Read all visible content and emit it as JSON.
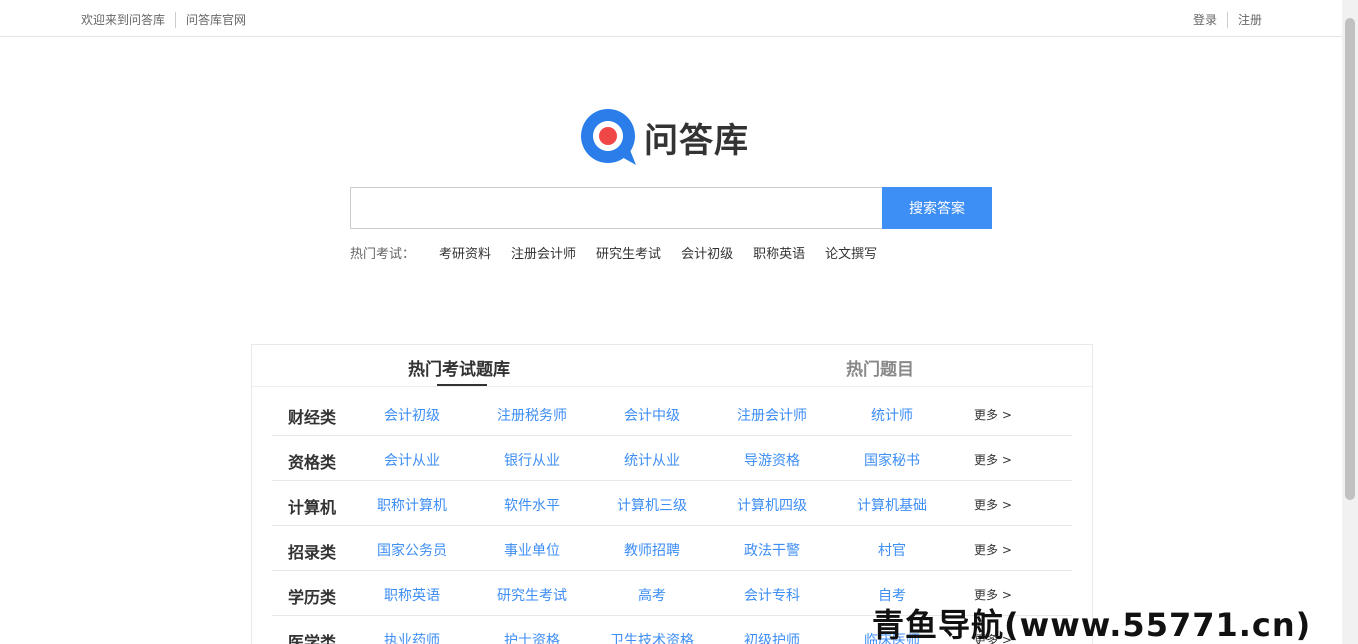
{
  "topbar": {
    "welcome": "欢迎来到问答库",
    "official_site": "问答库官网",
    "login": "登录",
    "register": "注册"
  },
  "logo": {
    "text": "问答库",
    "accent_blue": "#2b7de9",
    "accent_red": "#f04646"
  },
  "search": {
    "value": "",
    "placeholder": "",
    "button_label": "搜索答案"
  },
  "hot_exams": {
    "label": "热门考试：",
    "items": [
      "考研资料",
      "注册会计师",
      "研究生考试",
      "会计初级",
      "职称英语",
      "论文撰写"
    ]
  },
  "tabs": [
    {
      "label": "热门考试题库"
    },
    {
      "label": "热门题目"
    }
  ],
  "categories": [
    {
      "name": "财经类",
      "links": [
        "会计初级",
        "注册税务师",
        "会计中级",
        "注册会计师",
        "统计师"
      ],
      "more": "更多 >"
    },
    {
      "name": "资格类",
      "links": [
        "会计从业",
        "银行从业",
        "统计从业",
        "导游资格",
        "国家秘书"
      ],
      "more": "更多 >"
    },
    {
      "name": "计算机",
      "links": [
        "职称计算机",
        "软件水平",
        "计算机三级",
        "计算机四级",
        "计算机基础"
      ],
      "more": "更多 >"
    },
    {
      "name": "招录类",
      "links": [
        "国家公务员",
        "事业单位",
        "教师招聘",
        "政法干警",
        "村官"
      ],
      "more": "更多 >"
    },
    {
      "name": "学历类",
      "links": [
        "职称英语",
        "研究生考试",
        "高考",
        "会计专科",
        "自考"
      ],
      "more": "更多 >"
    },
    {
      "name": "医学类",
      "links": [
        "执业药师",
        "护士资格",
        "卫生技术资格",
        "初级护师",
        "临床医师"
      ],
      "more": "更多 >"
    }
  ],
  "watermark": "青鱼导航(www.55771.cn)",
  "colors": {
    "primary": "#3d8ef5",
    "text": "#333333",
    "muted": "#666666"
  }
}
